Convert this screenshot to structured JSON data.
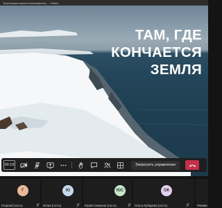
{
  "window": {
    "title": "Трансляция экрана пользователя — Teams"
  },
  "slide": {
    "headline": [
      "ТАМ, ГДЕ",
      "КОНЧАЕТСЯ",
      "ЗЕМЛЯ"
    ]
  },
  "controls": {
    "timer": "00:19",
    "request_control_label": "Запросить управление"
  },
  "participants": [
    {
      "initial": "Г",
      "name": "Георгий (гость)",
      "color": "#e8b99a"
    },
    {
      "initial": "Ю",
      "name": "Юлия (гость)",
      "color": "#c6d9ef"
    },
    {
      "initial": "ЮС",
      "name": "Юрий Симонов (гость)",
      "color": "#c7e8c9"
    },
    {
      "initial": "ОК",
      "name": "Ольга Кубарева (гость)",
      "color": "#e2d1f0"
    },
    {
      "initial": "",
      "name": "Ревиви",
      "color": "#cccccc"
    }
  ]
}
